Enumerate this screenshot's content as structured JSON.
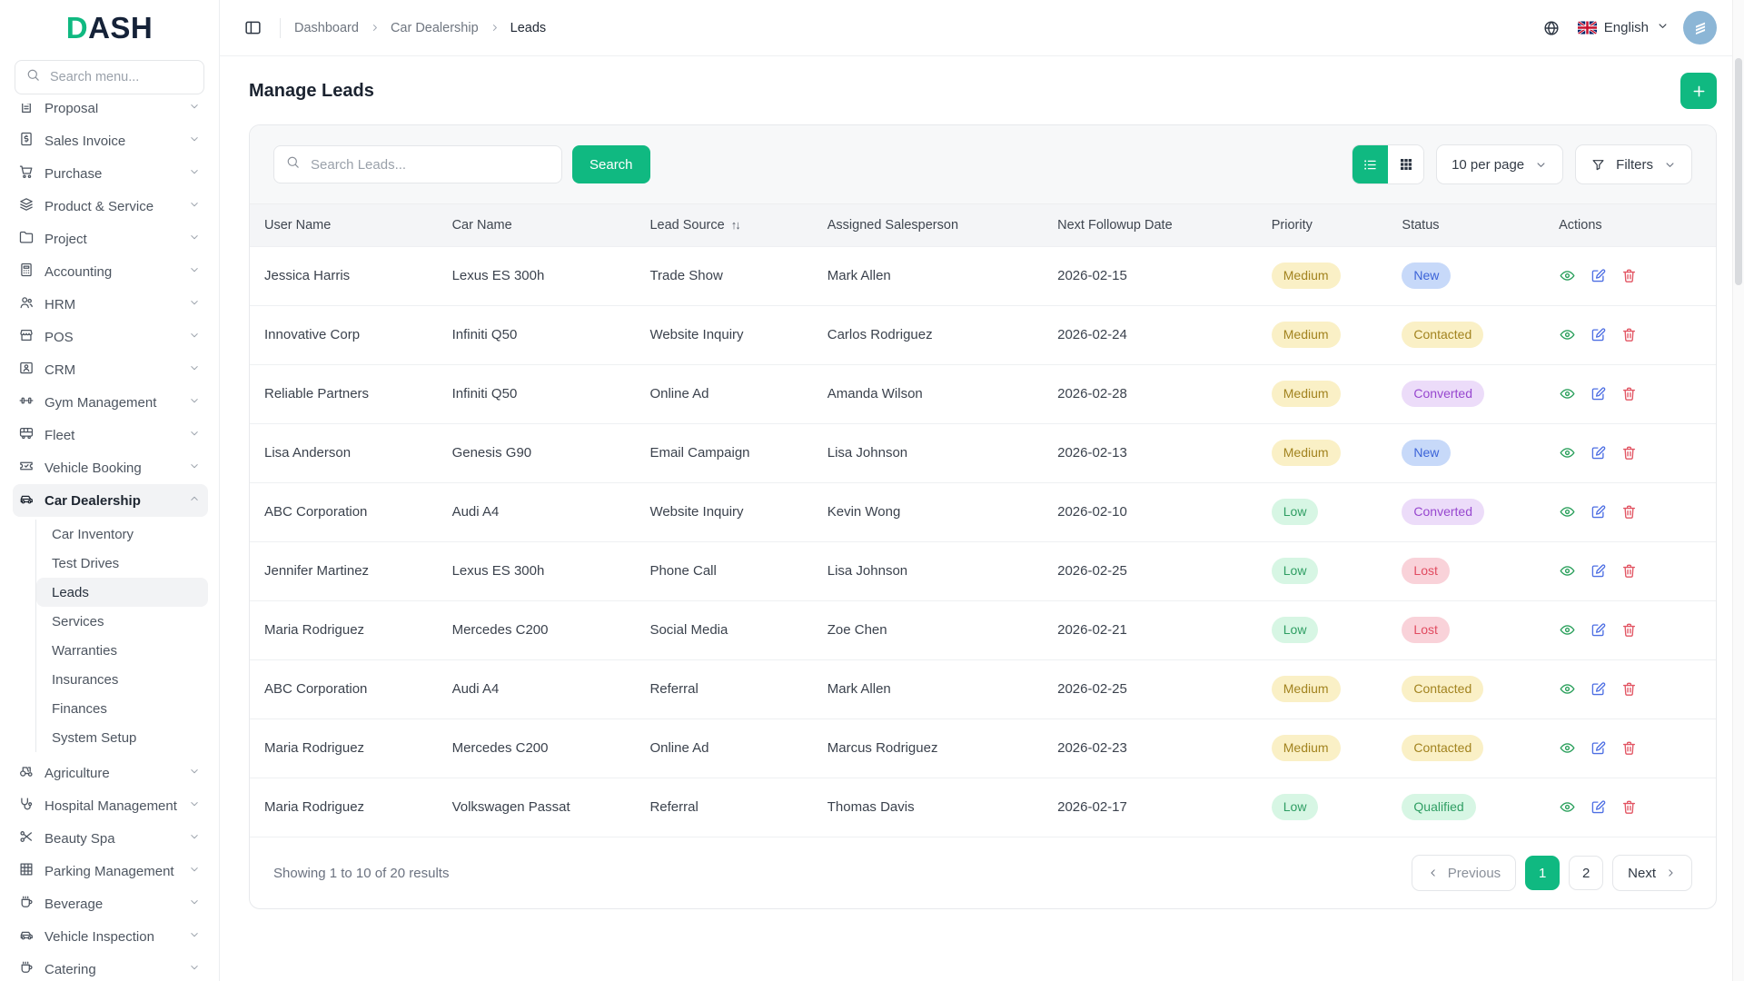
{
  "brand": {
    "logo_accent": "D",
    "logo_rest": "ASH"
  },
  "colors": {
    "accent": "#10b981",
    "sidebar_active_bg": "#f2f3f5",
    "card_toolbar_bg": "#f7f8f9",
    "table_header_bg": "#f4f5f7",
    "avatar_bg": "#8cb6d6"
  },
  "sidebar": {
    "search_placeholder": "Search menu...",
    "items": [
      {
        "label": "Proposal",
        "icon": "file-text-icon"
      },
      {
        "label": "Sales Invoice",
        "icon": "invoice-icon"
      },
      {
        "label": "Purchase",
        "icon": "cart-icon"
      },
      {
        "label": "Product & Service",
        "icon": "layers-icon"
      },
      {
        "label": "Project",
        "icon": "folder-icon"
      },
      {
        "label": "Accounting",
        "icon": "calculator-icon"
      },
      {
        "label": "HRM",
        "icon": "users-icon"
      },
      {
        "label": "POS",
        "icon": "store-icon"
      },
      {
        "label": "CRM",
        "icon": "id-card-icon"
      },
      {
        "label": "Gym Management",
        "icon": "dumbbell-icon"
      },
      {
        "label": "Fleet",
        "icon": "bus-icon"
      },
      {
        "label": "Vehicle Booking",
        "icon": "ticket-icon"
      },
      {
        "label": "Car Dealership",
        "icon": "car-icon",
        "active": true,
        "expanded": true,
        "children": [
          "Car Inventory",
          "Test Drives",
          "Leads",
          "Services",
          "Warranties",
          "Insurances",
          "Finances",
          "System Setup"
        ],
        "active_child": "Leads"
      },
      {
        "label": "Agriculture",
        "icon": "tractor-icon"
      },
      {
        "label": "Hospital Management",
        "icon": "stethoscope-icon"
      },
      {
        "label": "Beauty Spa",
        "icon": "scissors-icon"
      },
      {
        "label": "Parking Management",
        "icon": "grid-icon"
      },
      {
        "label": "Beverage",
        "icon": "cup-icon"
      },
      {
        "label": "Vehicle Inspection",
        "icon": "car-icon"
      },
      {
        "label": "Catering",
        "icon": "cup-icon"
      }
    ]
  },
  "header": {
    "breadcrumbs": [
      "Dashboard",
      "Car Dealership",
      "Leads"
    ],
    "language": "English",
    "language_icons": [
      "globe-icon",
      "uk-flag-icon",
      "chevron-down-icon"
    ],
    "avatar_icon": "building-logo-icon"
  },
  "page": {
    "title": "Manage Leads",
    "add_icon": "plus-icon"
  },
  "toolbar": {
    "search_placeholder": "Search Leads...",
    "search_button": "Search",
    "view_icons": [
      "list-view-icon",
      "grid-view-icon"
    ],
    "per_page": "10 per page",
    "filters": "Filters",
    "filter_icon": "filter-icon"
  },
  "table": {
    "columns": [
      {
        "label": "User Name"
      },
      {
        "label": "Car Name"
      },
      {
        "label": "Lead Source",
        "sortable": true
      },
      {
        "label": "Assigned Salesperson"
      },
      {
        "label": "Next Followup Date"
      },
      {
        "label": "Priority"
      },
      {
        "label": "Status"
      },
      {
        "label": "Actions"
      }
    ],
    "action_icons": [
      "eye-icon",
      "edit-icon",
      "trash-icon"
    ],
    "rows": [
      {
        "user": "Jessica Harris",
        "car": "Lexus ES 300h",
        "source": "Trade Show",
        "salesperson": "Mark Allen",
        "date": "2026-02-15",
        "priority": "Medium",
        "status": "New"
      },
      {
        "user": "Innovative Corp",
        "car": "Infiniti Q50",
        "source": "Website Inquiry",
        "salesperson": "Carlos Rodriguez",
        "date": "2026-02-24",
        "priority": "Medium",
        "status": "Contacted"
      },
      {
        "user": "Reliable Partners",
        "car": "Infiniti Q50",
        "source": "Online Ad",
        "salesperson": "Amanda Wilson",
        "date": "2026-02-28",
        "priority": "Medium",
        "status": "Converted"
      },
      {
        "user": "Lisa Anderson",
        "car": "Genesis G90",
        "source": "Email Campaign",
        "salesperson": "Lisa Johnson",
        "date": "2026-02-13",
        "priority": "Medium",
        "status": "New"
      },
      {
        "user": "ABC Corporation",
        "car": "Audi A4",
        "source": "Website Inquiry",
        "salesperson": "Kevin Wong",
        "date": "2026-02-10",
        "priority": "Low",
        "status": "Converted"
      },
      {
        "user": "Jennifer Martinez",
        "car": "Lexus ES 300h",
        "source": "Phone Call",
        "salesperson": "Lisa Johnson",
        "date": "2026-02-25",
        "priority": "Low",
        "status": "Lost"
      },
      {
        "user": "Maria Rodriguez",
        "car": "Mercedes C200",
        "source": "Social Media",
        "salesperson": "Zoe Chen",
        "date": "2026-02-21",
        "priority": "Low",
        "status": "Lost"
      },
      {
        "user": "ABC Corporation",
        "car": "Audi A4",
        "source": "Referral",
        "salesperson": "Mark Allen",
        "date": "2026-02-25",
        "priority": "Medium",
        "status": "Contacted"
      },
      {
        "user": "Maria Rodriguez",
        "car": "Mercedes C200",
        "source": "Online Ad",
        "salesperson": "Marcus Rodriguez",
        "date": "2026-02-23",
        "priority": "Medium",
        "status": "Contacted"
      },
      {
        "user": "Maria Rodriguez",
        "car": "Volkswagen Passat",
        "source": "Referral",
        "salesperson": "Thomas Davis",
        "date": "2026-02-17",
        "priority": "Low",
        "status": "Qualified"
      }
    ]
  },
  "badge_colors": {
    "Medium": {
      "bg": "#faf0c6",
      "text": "#a2831f"
    },
    "Low": {
      "bg": "#d7f6e4",
      "text": "#2f9e63"
    },
    "New": {
      "bg": "#c7d9f9",
      "text": "#3b63d8"
    },
    "Contacted": {
      "bg": "#faf0c6",
      "text": "#a2831f"
    },
    "Converted": {
      "bg": "#ecdcf9",
      "text": "#9747cf"
    },
    "Lost": {
      "bg": "#f9d2d9",
      "text": "#e14b60"
    },
    "Qualified": {
      "bg": "#d7f6e4",
      "text": "#2f9e63"
    }
  },
  "footer": {
    "summary": "Showing 1 to 10 of 20 results",
    "previous": "Previous",
    "pages": [
      "1",
      "2"
    ],
    "active_page": "1",
    "next": "Next"
  }
}
